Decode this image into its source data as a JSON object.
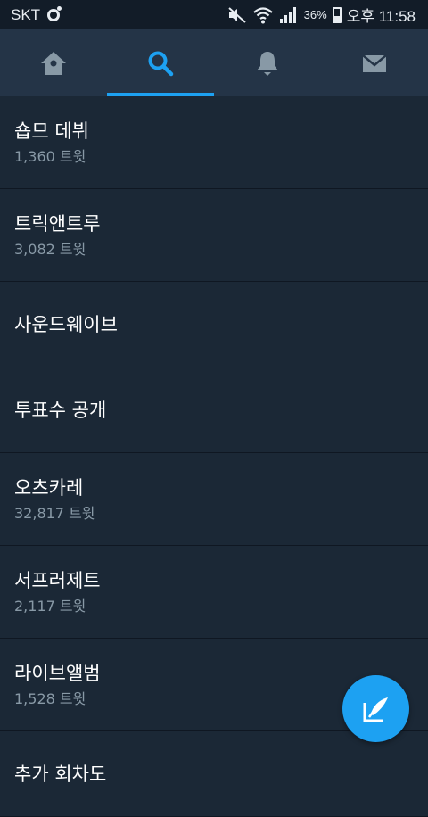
{
  "status_bar": {
    "carrier": "SKT",
    "battery_percent": "36%",
    "battery_level": 0.36,
    "time": "오후 11:58",
    "icons": [
      "mute-icon",
      "wifi-icon",
      "signal-icon",
      "battery-icon"
    ]
  },
  "tabs": [
    {
      "name": "home",
      "icon": "home-icon",
      "active": false
    },
    {
      "name": "search",
      "icon": "search-icon",
      "active": true
    },
    {
      "name": "notifications",
      "icon": "bell-icon",
      "active": false
    },
    {
      "name": "messages",
      "icon": "envelope-icon",
      "active": false
    }
  ],
  "trends": [
    {
      "name": "숍므 데뷔",
      "count": "1,360 트윗"
    },
    {
      "name": "트릭앤트루",
      "count": "3,082 트윗"
    },
    {
      "name": "사운드웨이브",
      "count": ""
    },
    {
      "name": "투표수 공개",
      "count": ""
    },
    {
      "name": "오츠카레",
      "count": "32,817 트윗"
    },
    {
      "name": "서프러제트",
      "count": "2,117 트윗"
    },
    {
      "name": "라이브앨범",
      "count": "1,528 트윗"
    },
    {
      "name": "추가 회차도",
      "count": ""
    }
  ],
  "colors": {
    "accent": "#1da1f2",
    "background": "#1b2836",
    "tab_bar": "#243447",
    "secondary_text": "#8899a6"
  },
  "fab": {
    "icon": "compose-tweet-icon"
  }
}
